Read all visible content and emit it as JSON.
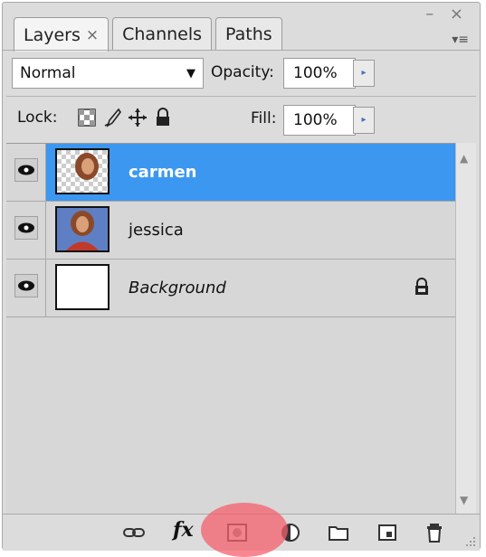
{
  "tabs": [
    {
      "label": "Layers",
      "close": "×"
    },
    {
      "label": "Channels"
    },
    {
      "label": "Paths"
    }
  ],
  "window_controls": "– ×",
  "panel_menu_glyph": "▾≡",
  "blend": {
    "mode": "Normal",
    "arrow": "▼"
  },
  "opacity": {
    "label": "Opacity:",
    "value": "100%",
    "arrow": "▸"
  },
  "lock": {
    "label": "Lock:"
  },
  "fill": {
    "label": "Fill:",
    "value": "100%",
    "arrow": "▸"
  },
  "layers": [
    {
      "name": "carmen",
      "selected": true
    },
    {
      "name": "jessica",
      "selected": false
    },
    {
      "name": "Background",
      "selected": false,
      "locked": true
    }
  ],
  "scroll": {
    "up": "▲",
    "down": "▼"
  },
  "bottom_icons": [
    "link-layers-icon",
    "fx-icon",
    "add-mask-icon",
    "adjustment-layer-icon",
    "new-group-icon",
    "new-layer-icon",
    "delete-layer-icon"
  ],
  "fx_text": "fx",
  "colors": {
    "selection": "#3c97f0",
    "highlight": "#f4606e",
    "panel": "#dcdcdc"
  }
}
